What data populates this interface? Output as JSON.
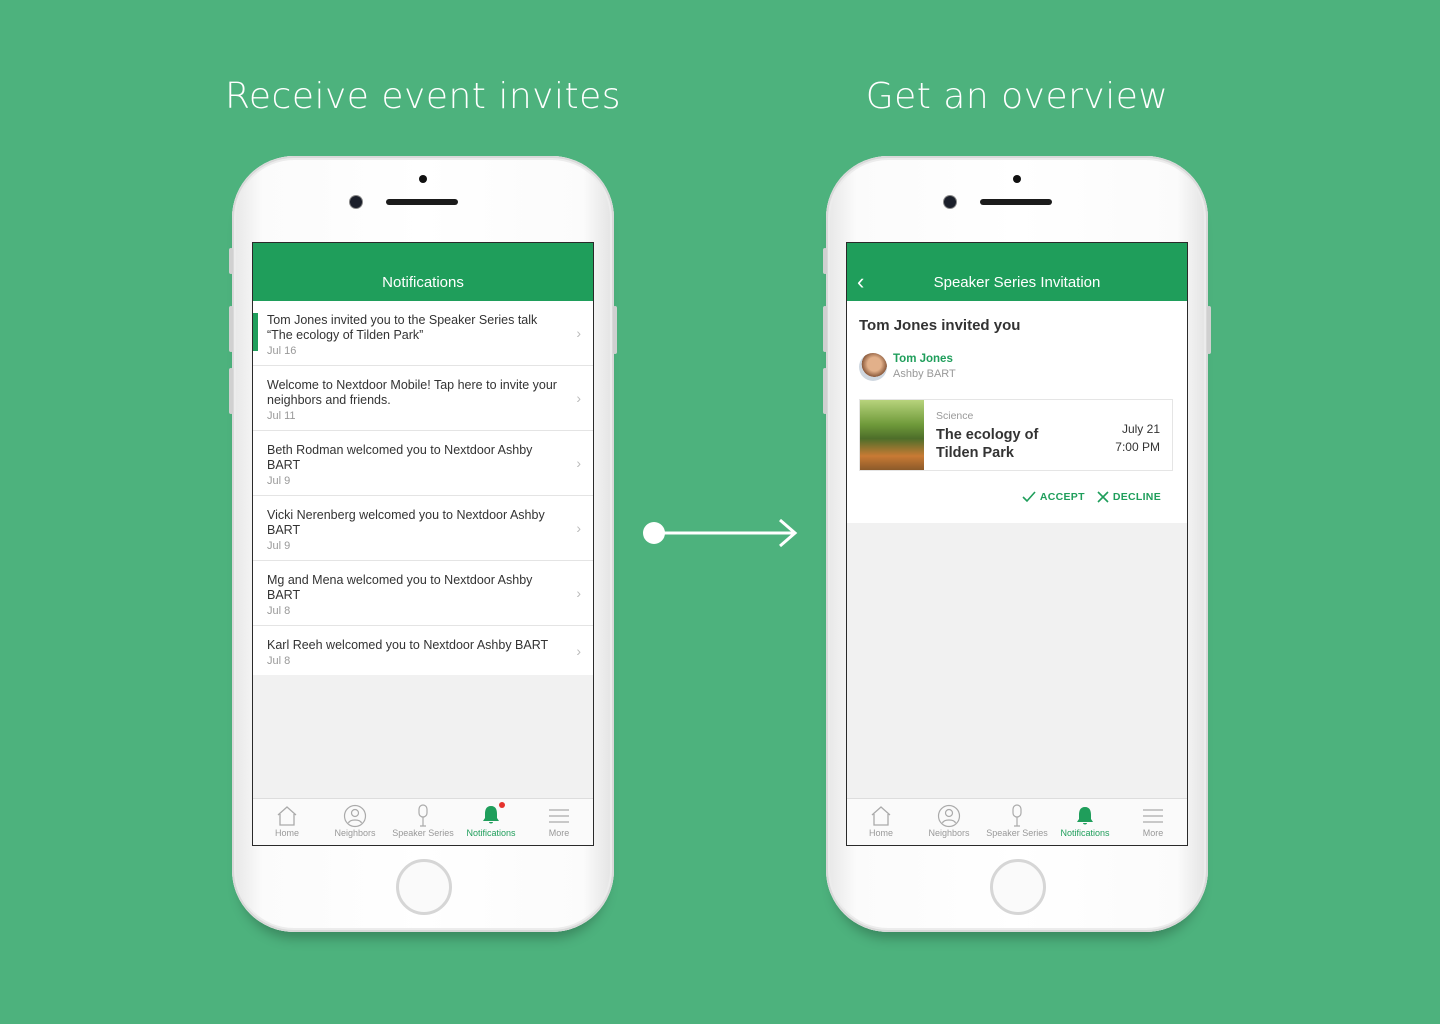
{
  "left_heading": "Receive event invites",
  "right_heading": "Get an overview",
  "notifications_screen": {
    "title": "Notifications",
    "items": [
      {
        "text": "Tom Jones invited you to the Speaker Series talk “The ecology of Tilden Park”",
        "date": "Jul 16",
        "unread": true
      },
      {
        "text": "Welcome to Nextdoor Mobile! Tap here to invite your neighbors and friends.",
        "date": "Jul 11",
        "unread": false
      },
      {
        "text": "Beth Rodman welcomed you to Nextdoor Ashby BART",
        "date": "Jul 9",
        "unread": false
      },
      {
        "text": "Vicki Nerenberg welcomed you to Nextdoor Ashby BART",
        "date": "Jul 9",
        "unread": false
      },
      {
        "text": "Mg and Mena welcomed you to Nextdoor Ashby BART",
        "date": "Jul 8",
        "unread": false
      },
      {
        "text": "Karl Reeh welcomed you to Nextdoor Ashby BART",
        "date": "Jul 8",
        "unread": false
      }
    ]
  },
  "invitation_screen": {
    "title": "Speaker Series Invitation",
    "heading": "Tom Jones invited you",
    "inviter_name": "Tom Jones",
    "inviter_location": "Ashby BART",
    "event_category": "Science",
    "event_title": "The ecology of Tilden Park",
    "event_date": "July 21",
    "event_time": "7:00 PM",
    "accept_label": "ACCEPT",
    "decline_label": "DECLINE"
  },
  "tabs": [
    {
      "label": "Home",
      "icon": "home-icon"
    },
    {
      "label": "Neighbors",
      "icon": "neighbors-icon"
    },
    {
      "label": "Speaker Series",
      "icon": "microphone-icon"
    },
    {
      "label": "Notifications",
      "icon": "bell-icon"
    },
    {
      "label": "More",
      "icon": "menu-icon"
    }
  ],
  "colors": {
    "background": "#4db27d",
    "accent": "#1f9e5b",
    "badge": "#e5322d"
  }
}
